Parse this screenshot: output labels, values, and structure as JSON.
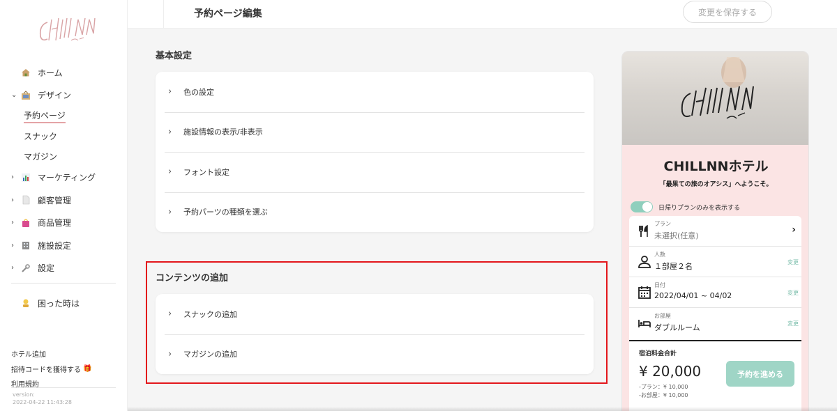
{
  "sidebar": {
    "logo_text": "CHILLNN",
    "nav": [
      {
        "label": "ホーム",
        "icon": "home-icon"
      },
      {
        "label": "デザイン",
        "icon": "design-icon",
        "expanded": true
      },
      {
        "label": "マーケティング",
        "icon": "chart-icon"
      },
      {
        "label": "顧客管理",
        "icon": "document-icon"
      },
      {
        "label": "商品管理",
        "icon": "shopping-bag-icon"
      },
      {
        "label": "施設設定",
        "icon": "building-icon"
      },
      {
        "label": "設定",
        "icon": "wrench-icon"
      },
      {
        "label": "困った時は",
        "icon": "help-person-icon"
      }
    ],
    "design_sub": [
      "予約ページ",
      "スナック",
      "マガジン"
    ],
    "bottom_links": [
      "ホテル追加",
      "招待コードを獲得する",
      "利用規約"
    ],
    "version_label": "version:",
    "version_value": "2022-04-22 11:43:28"
  },
  "header": {
    "title": "予約ページ編集",
    "save_label": "変更を保存する"
  },
  "main": {
    "basic_title": "基本設定",
    "basic_items": [
      "色の設定",
      "施設情報の表示/非表示",
      "フォント設定",
      "予約パーツの種類を選ぶ"
    ],
    "contents_title": "コンテンツの追加",
    "contents_items": [
      "スナックの追加",
      "マガジンの追加"
    ]
  },
  "preview": {
    "hotel_name": "CHILLNNホテル",
    "welcome": "「最果ての旅のオアシス」へようこそ。",
    "toggle_label": "日帰りプランのみを表示する",
    "plan_label": "プラン",
    "plan_value": "未選択(任意)",
    "people_label": "人数",
    "people_value": "１部屋２名",
    "date_label": "日付",
    "date_value": "2022/04/01 ~ 04/02",
    "room_label": "お部屋",
    "room_value": "ダブルルーム",
    "change_label": "変更",
    "total_label": "宿泊料金合計",
    "total_price": "¥ 20,000",
    "breakdown_plan": "-プラン：¥ 10,000",
    "breakdown_room": "-お部屋：¥ 10,000",
    "proceed_label": "予約を進める"
  },
  "colors": {
    "accent_pink": "#e4a3a6",
    "highlight_red": "#e3161b",
    "mint": "#9fd5c6",
    "preview_bg": "#fbe4e4"
  }
}
